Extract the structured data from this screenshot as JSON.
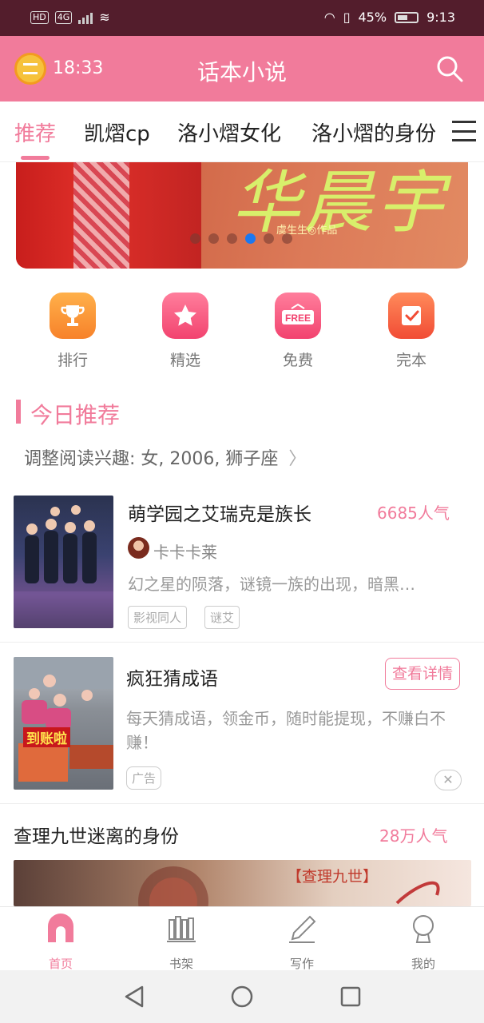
{
  "status_bar": {
    "left_chips": [
      "HD",
      "4G"
    ],
    "battery": "45%",
    "time": "9:13"
  },
  "header": {
    "timer": "18:33",
    "title": "话本小说",
    "icons": [
      "alarm-clock-icon",
      "search-icon"
    ]
  },
  "tabs": [
    {
      "label": "推荐",
      "active": true
    },
    {
      "label": "凯熠cp",
      "active": false
    },
    {
      "label": "洛小熠女化",
      "active": false
    },
    {
      "label": "洛小熠的身份",
      "active": false
    }
  ],
  "banner": {
    "art_text": "华晨宇",
    "sub_text": "虞生生◎作品",
    "slide_count": 6,
    "active_slide": 4
  },
  "quick_links": [
    {
      "label": "排行",
      "icon": "trophy-icon",
      "color": "#f7962f"
    },
    {
      "label": "精选",
      "icon": "star-icon",
      "color": "#f4557c"
    },
    {
      "label": "免费",
      "icon": "free-icon",
      "color": "#f4557c"
    },
    {
      "label": "完本",
      "icon": "checkbook-icon",
      "color": "#f25d3e"
    }
  ],
  "section": {
    "title": "今日推荐",
    "interest": "调整阅读兴趣: 女, 2006, 狮子座"
  },
  "books": [
    {
      "title": "萌学园之艾瑞克是族长",
      "popularity": "6685人气",
      "author": "卡卡卡莱",
      "description": "幻之星的陨落，谜镜一族的出现，暗黑…",
      "tags": [
        "影视同人",
        "谜艾"
      ]
    }
  ],
  "ad": {
    "title": "疯狂猜成语",
    "button": "查看详情",
    "description": "每天猜成语，领金币，随时能提现，不赚白不赚！",
    "tag": "广告",
    "cover_text": "到账啦"
  },
  "feature": {
    "title": "查理九世迷离的身份",
    "popularity": "28万人气",
    "cover_text": "【查理九世】"
  },
  "bottom_nav": [
    {
      "label": "首页",
      "icon": "home-icon",
      "active": true
    },
    {
      "label": "书架",
      "icon": "bookshelf-icon",
      "active": false
    },
    {
      "label": "写作",
      "icon": "pen-icon",
      "active": false
    },
    {
      "label": "我的",
      "icon": "profile-icon",
      "active": false
    }
  ],
  "colors": {
    "accent": "#f17b9b",
    "status_bar": "#531d2c"
  }
}
